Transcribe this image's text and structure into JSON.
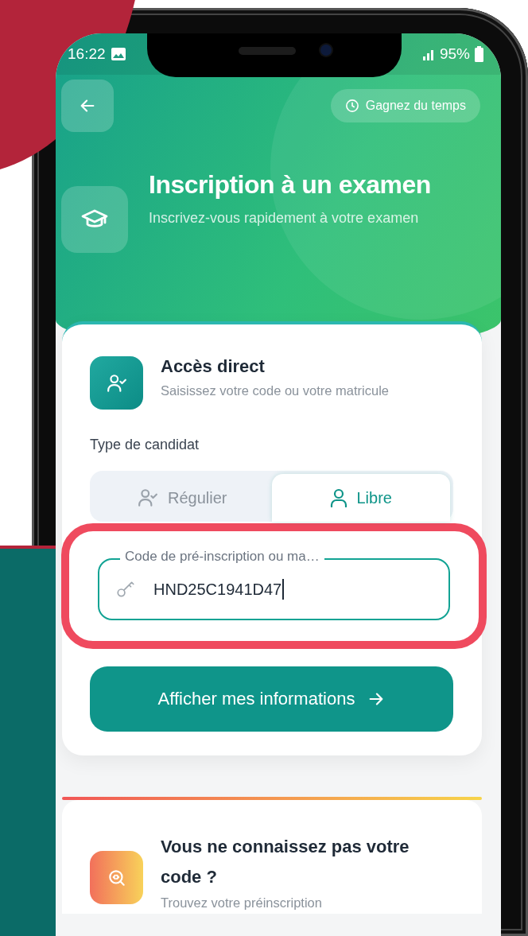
{
  "status_bar": {
    "time": "16:22",
    "battery": "95%"
  },
  "header": {
    "badge": "Gagnez du temps",
    "title": "Inscription à un examen",
    "subtitle": "Inscrivez-vous rapidement à votre examen"
  },
  "access_card": {
    "title": "Accès direct",
    "subtitle": "Saisissez votre code ou votre matricule",
    "type_label": "Type de candidat",
    "tabs": [
      {
        "label": "Régulier",
        "selected": false
      },
      {
        "label": "Libre",
        "selected": true
      }
    ],
    "field": {
      "label": "Code de pré-inscription ou ma…",
      "value": "HND25C1941D47",
      "highlighted": true
    },
    "button": "Afficher mes informations"
  },
  "help_card": {
    "title": "Vous ne connaissez pas votre code ?",
    "subtitle": "Trouvez votre préinscription"
  }
}
